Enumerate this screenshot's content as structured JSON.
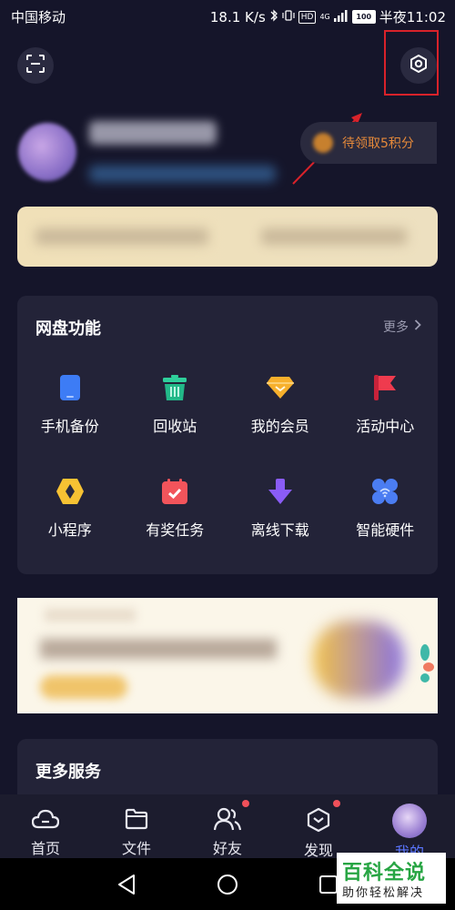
{
  "status_bar": {
    "carrier": "中国移动",
    "speed": "18.1 K/s",
    "network_badge": "HD",
    "network_type": "4G",
    "battery": "100",
    "time": "半夜11:02"
  },
  "profile": {
    "points_label": "待领取5积分"
  },
  "features": {
    "title": "网盘功能",
    "more_label": "更多",
    "items": [
      {
        "label": "手机备份",
        "icon": "phone-backup-icon",
        "color": "#3d7cf5"
      },
      {
        "label": "回收站",
        "icon": "recycle-bin-icon",
        "color": "#2fcf9b"
      },
      {
        "label": "我的会员",
        "icon": "diamond-icon",
        "color": "#f7b02c"
      },
      {
        "label": "活动中心",
        "icon": "flag-icon",
        "color": "#ef3b4e"
      },
      {
        "label": "小程序",
        "icon": "mini-program-icon",
        "color": "#f7c233"
      },
      {
        "label": "有奖任务",
        "icon": "calendar-check-icon",
        "color": "#f2545b"
      },
      {
        "label": "离线下载",
        "icon": "download-arrow-icon",
        "color": "#8a5cf6"
      },
      {
        "label": "智能硬件",
        "icon": "hardware-icon",
        "color": "#4b7df2"
      }
    ]
  },
  "services": {
    "title": "更多服务"
  },
  "bottom_nav": [
    {
      "label": "首页",
      "icon": "cloud-home-icon"
    },
    {
      "label": "文件",
      "icon": "folder-icon"
    },
    {
      "label": "好友",
      "icon": "friends-icon"
    },
    {
      "label": "发现",
      "icon": "discover-icon"
    },
    {
      "label": "我的",
      "icon": "avatar"
    }
  ],
  "watermark": {
    "title": "百科全说",
    "subtitle": "助你轻松解决"
  },
  "colors": {
    "background": "#15152a",
    "card": "#232338",
    "accent": "#5b76ff",
    "points": "#e5893a",
    "highlight_box": "#d8222a"
  }
}
